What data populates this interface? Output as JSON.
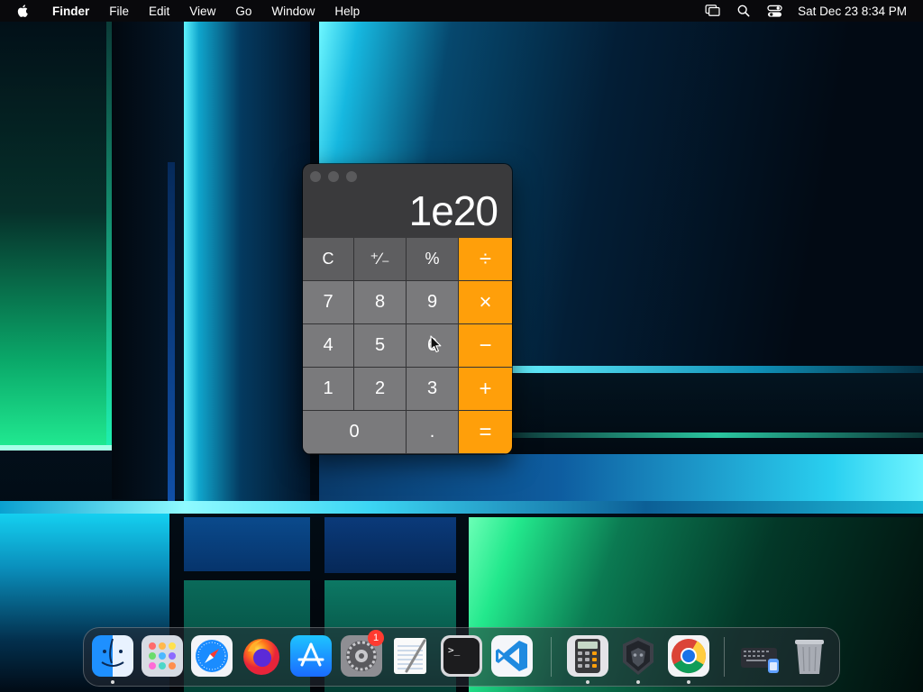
{
  "menubar": {
    "app_name": "Finder",
    "menus": [
      "File",
      "Edit",
      "View",
      "Go",
      "Window",
      "Help"
    ],
    "clock": "Sat Dec 23  8:34 PM",
    "status_icons": [
      "screen-mirroring-icon",
      "search-icon",
      "control-center-icon"
    ]
  },
  "calculator": {
    "display": "1e20",
    "keys": [
      {
        "label": "C",
        "kind": "fn",
        "name": "clear"
      },
      {
        "label": "⁺∕₋",
        "kind": "fn",
        "name": "plus-minus"
      },
      {
        "label": "%",
        "kind": "fn",
        "name": "percent"
      },
      {
        "label": "÷",
        "kind": "op",
        "name": "divide"
      },
      {
        "label": "7",
        "kind": "num",
        "name": "7"
      },
      {
        "label": "8",
        "kind": "num",
        "name": "8"
      },
      {
        "label": "9",
        "kind": "num",
        "name": "9"
      },
      {
        "label": "×",
        "kind": "op",
        "name": "multiply"
      },
      {
        "label": "4",
        "kind": "num",
        "name": "4"
      },
      {
        "label": "5",
        "kind": "num",
        "name": "5"
      },
      {
        "label": "6",
        "kind": "num",
        "name": "6"
      },
      {
        "label": "−",
        "kind": "op",
        "name": "subtract"
      },
      {
        "label": "1",
        "kind": "num",
        "name": "1"
      },
      {
        "label": "2",
        "kind": "num",
        "name": "2"
      },
      {
        "label": "3",
        "kind": "num",
        "name": "3"
      },
      {
        "label": "+",
        "kind": "op",
        "name": "add"
      },
      {
        "label": "0",
        "kind": "num",
        "name": "0"
      },
      {
        "label": ".",
        "kind": "num",
        "name": "decimal"
      },
      {
        "label": "=",
        "kind": "op",
        "name": "equals"
      }
    ],
    "colors": {
      "operator": "#ff9f0a",
      "number": "#7a7a7c",
      "function": "#5e5e60"
    }
  },
  "dock": {
    "items": [
      {
        "name": "finder",
        "running": true
      },
      {
        "name": "launchpad",
        "running": false
      },
      {
        "name": "safari",
        "running": false
      },
      {
        "name": "firefox",
        "running": false
      },
      {
        "name": "app-store",
        "running": false
      },
      {
        "name": "system-settings",
        "running": false,
        "badge": "1"
      },
      {
        "name": "textedit",
        "running": false
      },
      {
        "name": "terminal",
        "running": false
      },
      {
        "name": "vscode",
        "running": false
      },
      {
        "name": "calculator",
        "running": true
      },
      {
        "name": "privacy-app",
        "running": true
      },
      {
        "name": "chrome",
        "running": true
      },
      {
        "name": "downloads-stack",
        "running": false
      },
      {
        "name": "trash",
        "running": false
      }
    ]
  }
}
